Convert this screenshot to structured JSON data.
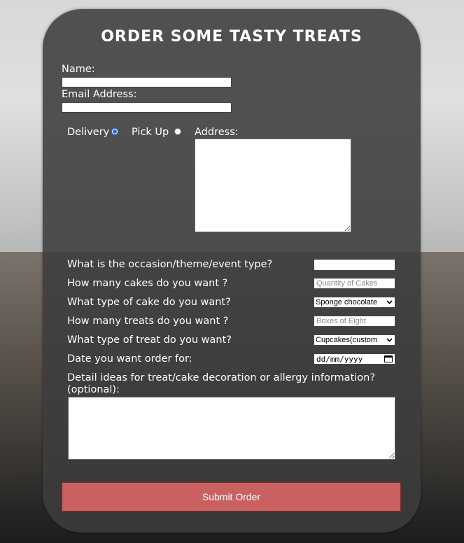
{
  "title": "ORDER SOME TASTY TREATS",
  "name": {
    "label": "Name:",
    "value": ""
  },
  "email": {
    "label": "Email Address:",
    "value": ""
  },
  "delivery_method": {
    "options": [
      "Delivery",
      "Pick Up"
    ],
    "selected": "Delivery"
  },
  "address": {
    "label": "Address:",
    "value": ""
  },
  "occasion": {
    "label": "What is the occasion/theme/event type?",
    "value": ""
  },
  "cake_quantity": {
    "label": "How many cakes do you want ?",
    "placeholder": "Quantity of Cakes"
  },
  "cake_type": {
    "label": "What type of cake do you want?",
    "selected": "Sponge chocolate"
  },
  "treat_quantity": {
    "label": "How many treats do you want ?",
    "placeholder": "Boxes of Eight"
  },
  "treat_type": {
    "label": "What type of treat do you want?",
    "selected": "Cupcakes(custom"
  },
  "order_date": {
    "label": "Date you want order for:",
    "value": "dd/mm/yyyy"
  },
  "details": {
    "label": "Detail ideas for treat/cake decoration or allergy information? (optional):",
    "value": ""
  },
  "submit_label": "Submit Order",
  "colors": {
    "card": "#3c3c3c",
    "submit": "#c96161",
    "radio_accent": "#1a73e8"
  }
}
